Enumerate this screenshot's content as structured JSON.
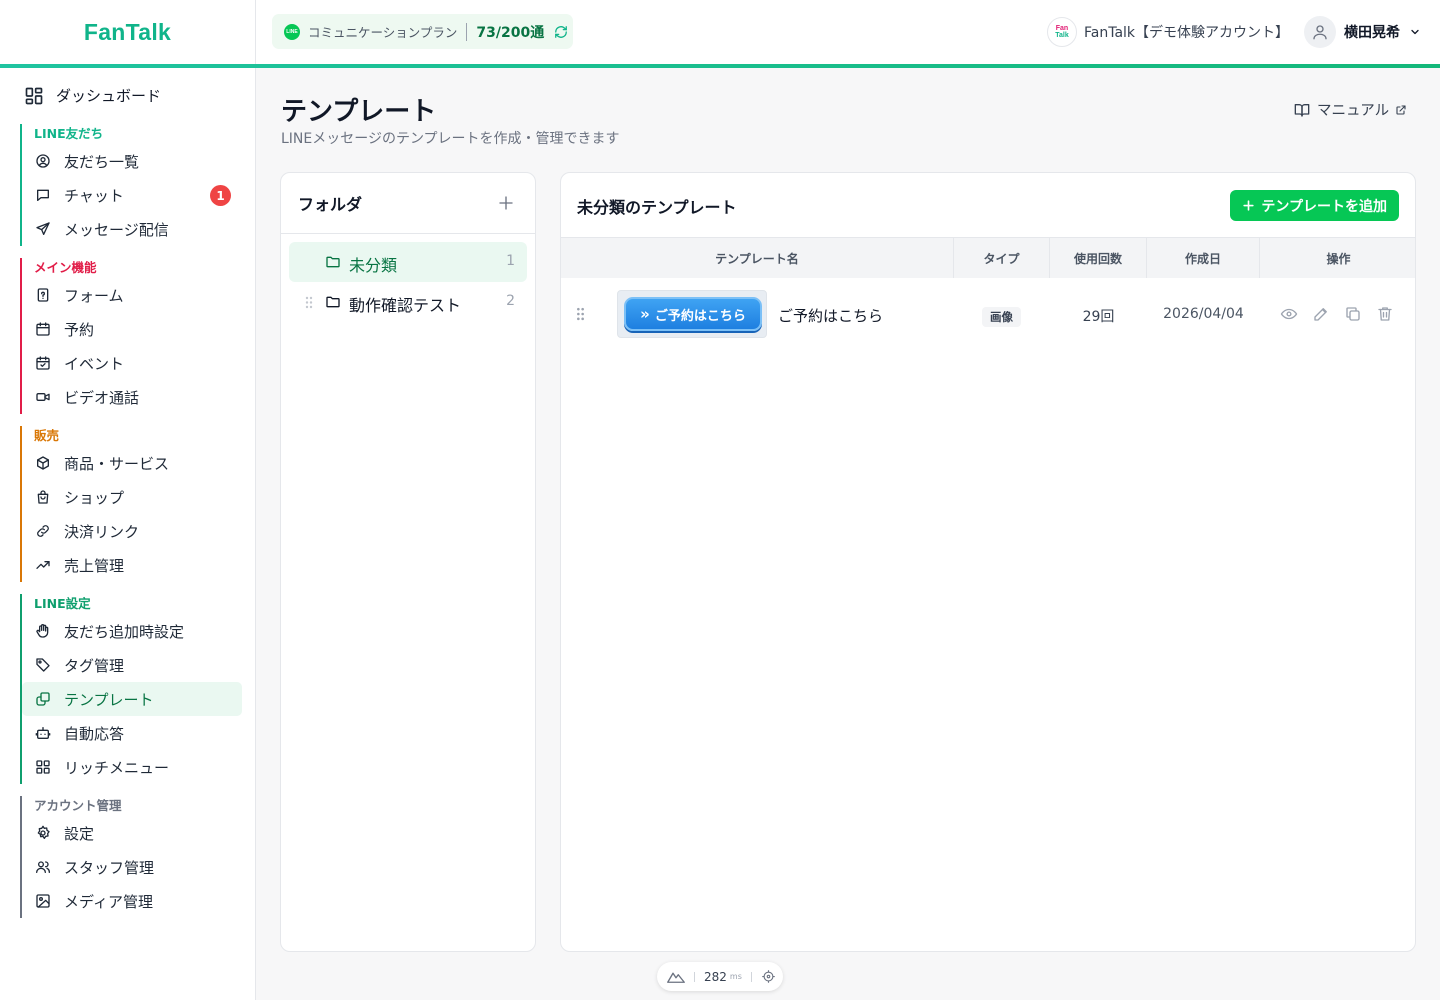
{
  "header": {
    "logo": "FanTalk",
    "plan": {
      "line_badge": "LINE",
      "name": "コミュニケーションプラン",
      "count": "73/200通"
    },
    "account": {
      "logo_top": "Fan",
      "logo_bottom": "Talk",
      "name": "FanTalk【デモ体験アカウント】"
    },
    "user": {
      "name": "横田晃希"
    }
  },
  "sidebar": {
    "dashboard": "ダッシュボード",
    "sections": [
      {
        "title": "LINE友だち",
        "color": "#10b48a",
        "items": [
          {
            "label": "友だち一覧",
            "icon": "user-circle-icon"
          },
          {
            "label": "チャット",
            "icon": "chat-bubble-icon",
            "badge": "1"
          },
          {
            "label": "メッセージ配信",
            "icon": "send-icon"
          }
        ]
      },
      {
        "title": "メイン機能",
        "color": "#e11d48",
        "items": [
          {
            "label": "フォーム",
            "icon": "form-icon"
          },
          {
            "label": "予約",
            "icon": "calendar-icon"
          },
          {
            "label": "イベント",
            "icon": "calendar-check-icon"
          },
          {
            "label": "ビデオ通話",
            "icon": "video-icon"
          }
        ]
      },
      {
        "title": "販売",
        "color": "#d97706",
        "items": [
          {
            "label": "商品・サービス",
            "icon": "box-icon"
          },
          {
            "label": "ショップ",
            "icon": "shopping-bag-icon"
          },
          {
            "label": "決済リンク",
            "icon": "link-icon"
          },
          {
            "label": "売上管理",
            "icon": "trending-up-icon"
          }
        ]
      },
      {
        "title": "LINE設定",
        "color": "#0f9f6e",
        "items": [
          {
            "label": "友だち追加時設定",
            "icon": "hand-icon"
          },
          {
            "label": "タグ管理",
            "icon": "tag-icon"
          },
          {
            "label": "テンプレート",
            "icon": "template-icon",
            "active": true
          },
          {
            "label": "自動応答",
            "icon": "bot-icon"
          },
          {
            "label": "リッチメニュー",
            "icon": "grid-icon"
          }
        ]
      },
      {
        "title": "アカウント管理",
        "color": "#6b7280",
        "items": [
          {
            "label": "設定",
            "icon": "gear-icon"
          },
          {
            "label": "スタッフ管理",
            "icon": "users-icon"
          },
          {
            "label": "メディア管理",
            "icon": "image-icon"
          }
        ]
      }
    ]
  },
  "page": {
    "title": "テンプレート",
    "subtitle": "LINEメッセージのテンプレートを作成・管理できます",
    "manual": "マニュアル"
  },
  "folders": {
    "title": "フォルダ",
    "items": [
      {
        "name": "未分類",
        "count": "1",
        "active": true
      },
      {
        "name": "動作確認テスト",
        "count": "2",
        "active": false
      }
    ]
  },
  "templates": {
    "title": "未分類のテンプレート",
    "add_button": "テンプレートを追加",
    "columns": [
      "テンプレート名",
      "タイプ",
      "使用回数",
      "作成日",
      "操作"
    ],
    "rows": [
      {
        "thumbnail_text": "ご予約はこちら",
        "name": "ご予約はこちら",
        "type": "画像",
        "usage": "29回",
        "created": "2026/04/04"
      }
    ]
  },
  "perf": {
    "value": "282",
    "unit": "ms"
  },
  "colors": {
    "accent": "#06c755",
    "brand": "#10b48a",
    "badge": "#ef4444"
  }
}
